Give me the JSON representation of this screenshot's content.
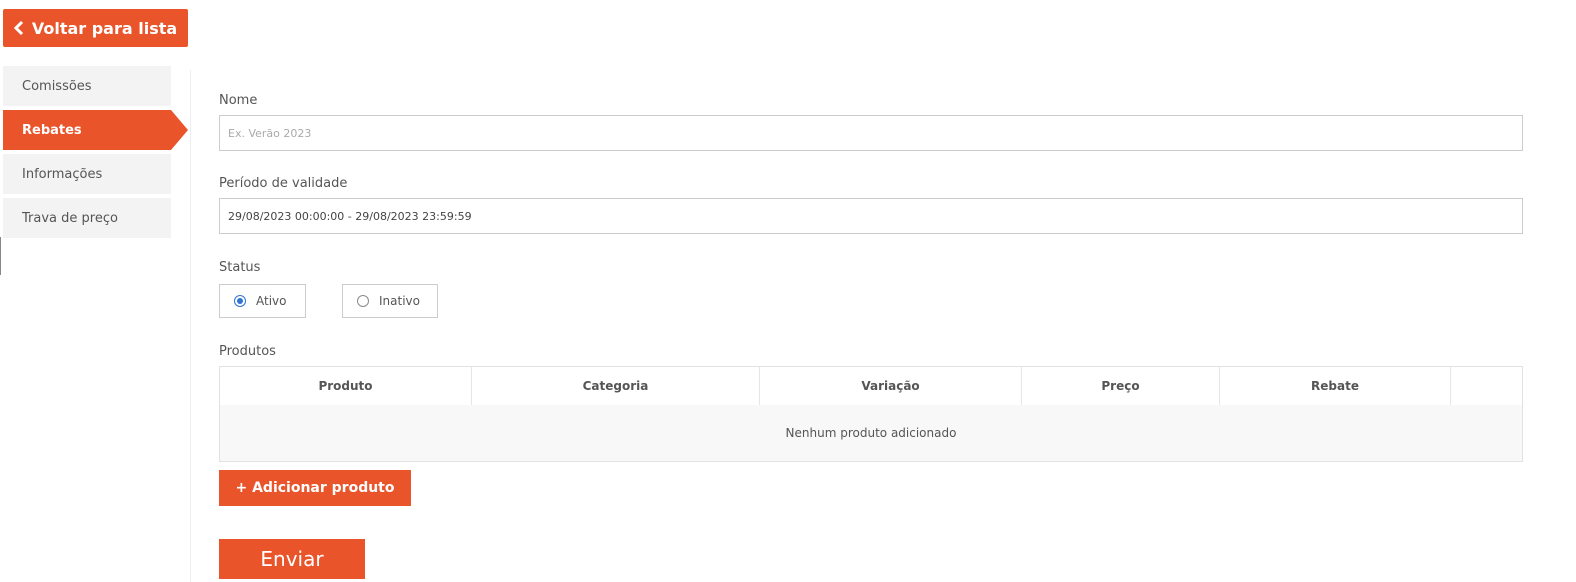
{
  "header": {
    "back_label": "Voltar para lista"
  },
  "sidebar": {
    "items": [
      {
        "label": "Comissões",
        "active": false
      },
      {
        "label": "Rebates",
        "active": true
      },
      {
        "label": "Informações",
        "active": false
      },
      {
        "label": "Trava de preço",
        "active": false
      }
    ]
  },
  "form": {
    "name_label": "Nome",
    "name_placeholder": "Ex. Verão 2023",
    "name_value": "",
    "period_label": "Período de validade",
    "period_value": "29/08/2023 00:00:00 - 29/08/2023 23:59:59",
    "status_label": "Status",
    "status_options": [
      {
        "label": "Ativo",
        "checked": true
      },
      {
        "label": "Inativo",
        "checked": false
      }
    ],
    "products_label": "Produtos",
    "table": {
      "columns": [
        "Produto",
        "Categoria",
        "Variação",
        "Preço",
        "Rebate",
        ""
      ],
      "empty_message": "Nenhum produto adicionado"
    },
    "add_product_label": "+ Adicionar produto",
    "submit_label": "Enviar"
  },
  "colors": {
    "accent": "#e9542a",
    "radio_checked": "#2f72d6",
    "sidebar_bg": "#f3f3f3"
  }
}
